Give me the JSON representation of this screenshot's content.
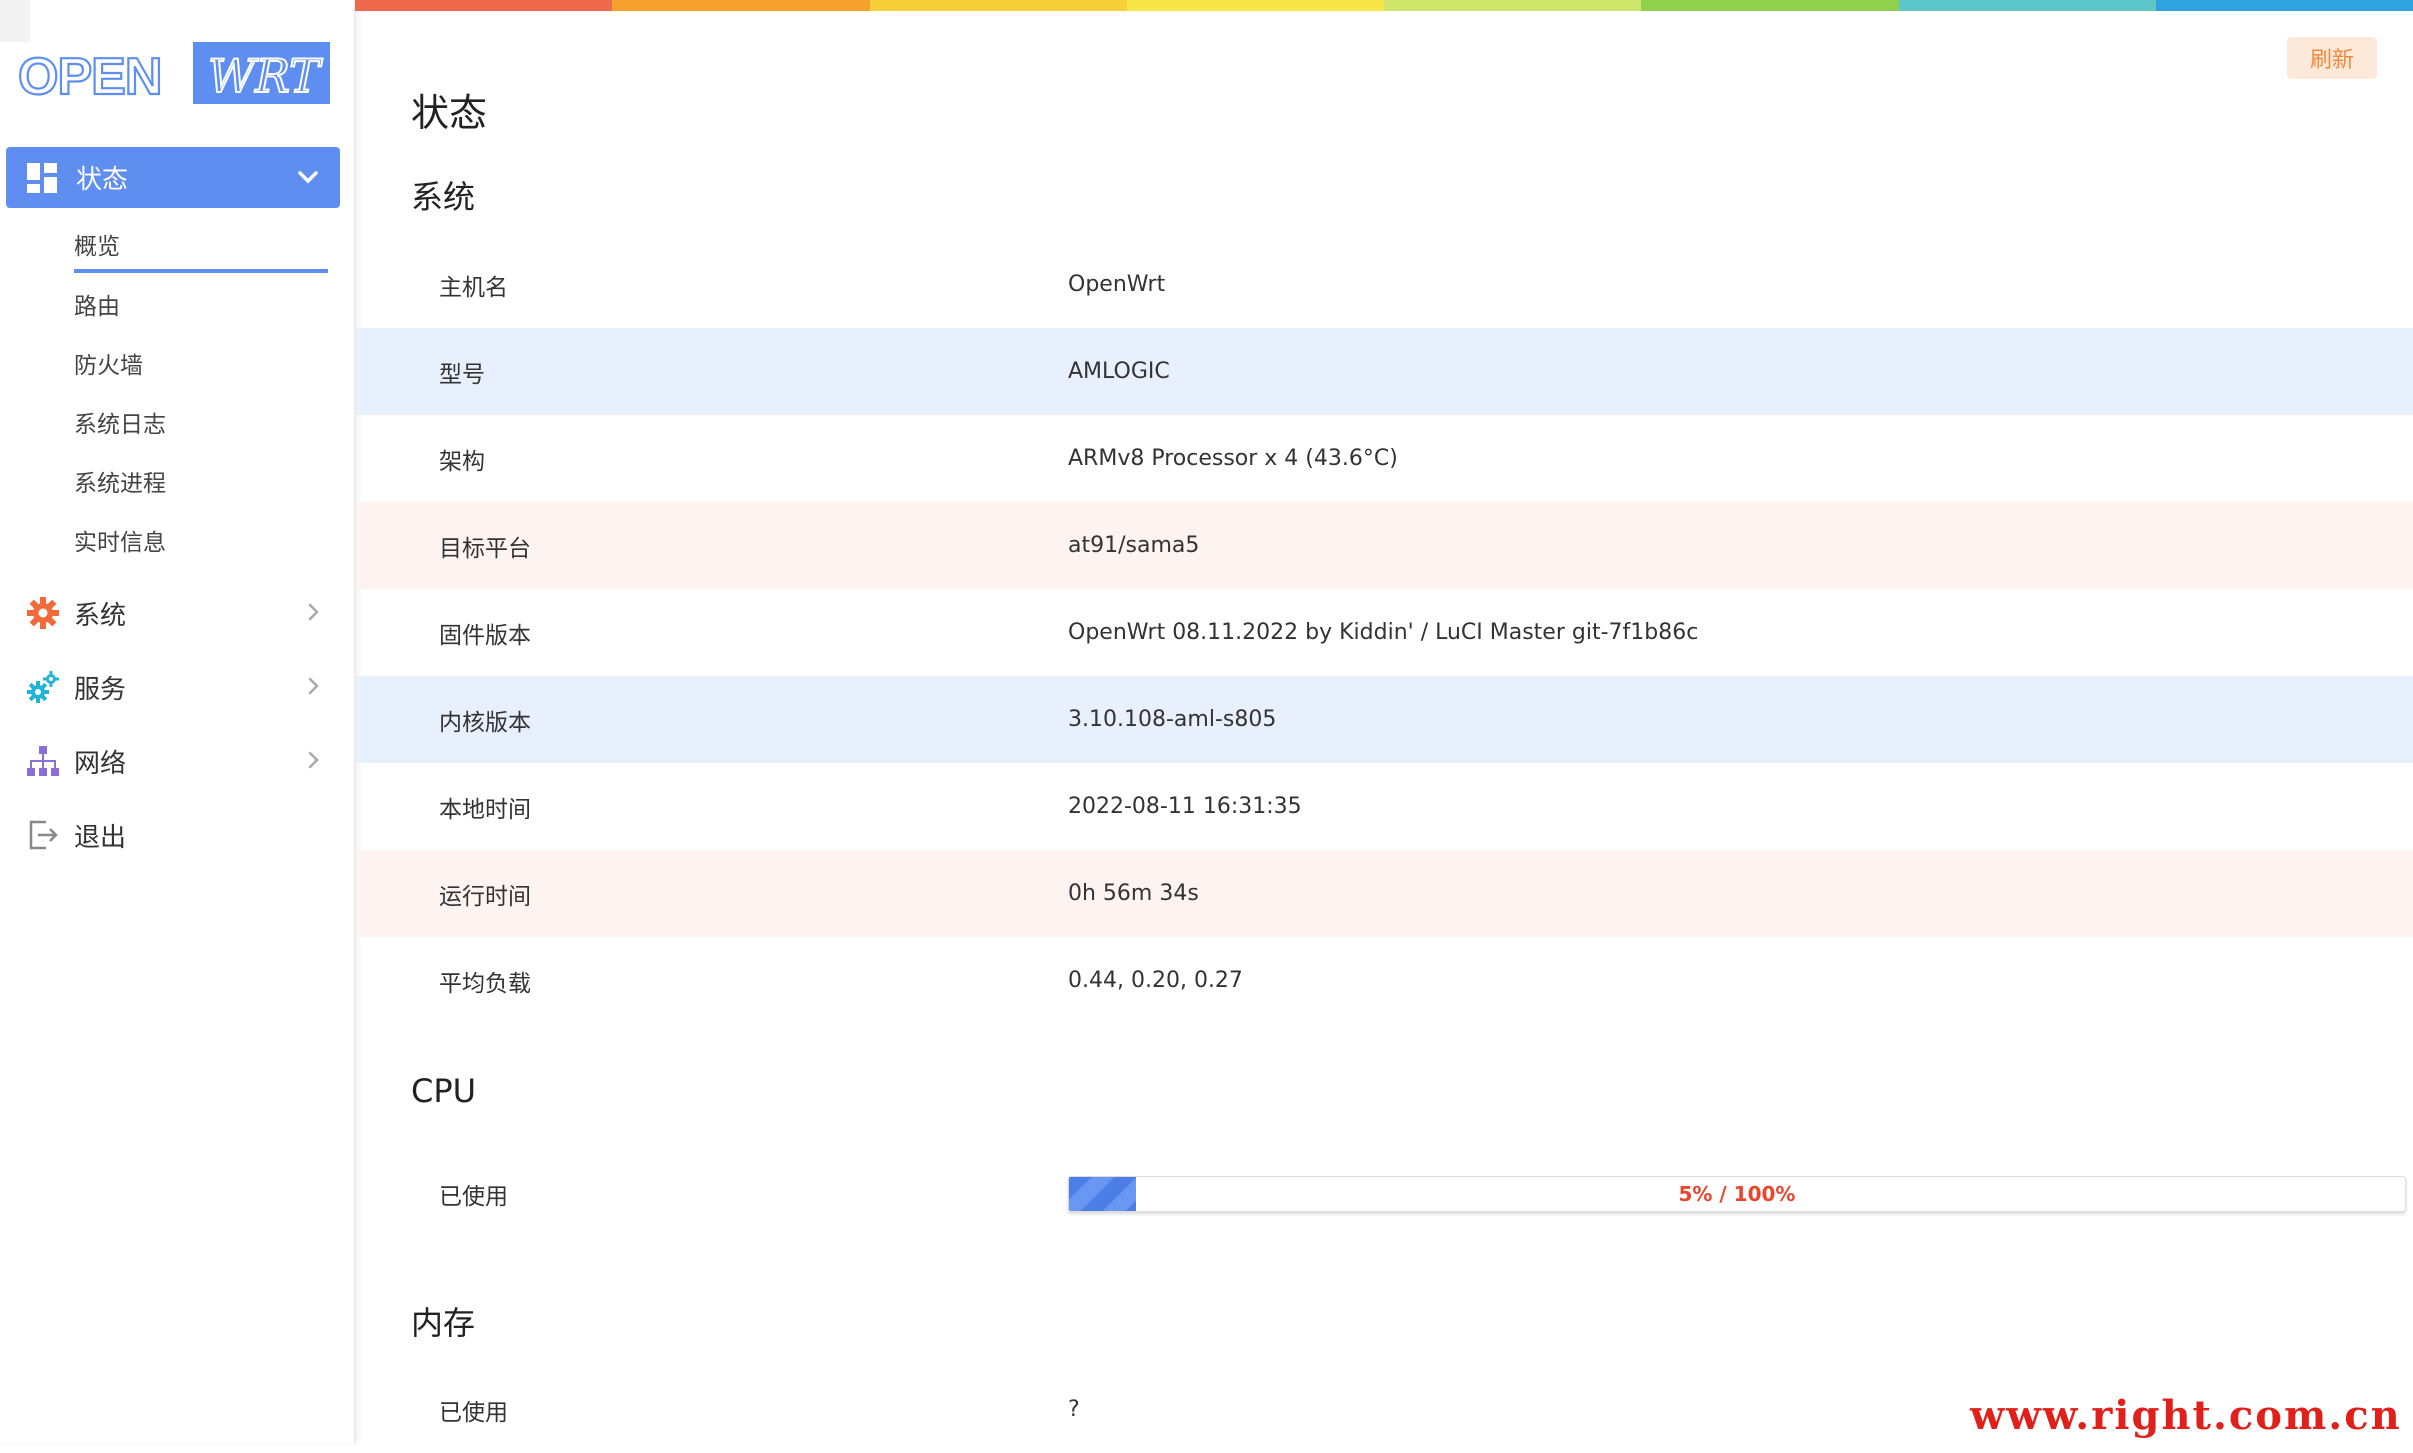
{
  "colors": {
    "accent": "#5e8ff0",
    "refresh_bg": "#fde9d9",
    "refresh_text": "#f08a3c",
    "row_blue": "#e8f0fd",
    "row_pink": "#fdf3f1",
    "progress_text": "#e8462d",
    "rainbow": [
      "#ee6a4b",
      "#f6a02e",
      "#f7cf3b",
      "#f8e548",
      "#cfe56a",
      "#8fd04c",
      "#5dc6c9",
      "#2ea3e0"
    ]
  },
  "logo": {
    "left": "OPEN",
    "right": "WRT"
  },
  "sidebar": {
    "active": {
      "label": "状态",
      "icon": "dashboard-icon"
    },
    "subitems": [
      {
        "label": "概览"
      },
      {
        "label": "路由"
      },
      {
        "label": "防火墙"
      },
      {
        "label": "系统日志"
      },
      {
        "label": "系统进程"
      },
      {
        "label": "实时信息"
      }
    ],
    "items": [
      {
        "label": "系统",
        "icon": "gear-icon"
      },
      {
        "label": "服务",
        "icon": "cogs-icon"
      },
      {
        "label": "网络",
        "icon": "network-icon"
      },
      {
        "label": "退出",
        "icon": "logout-icon"
      }
    ]
  },
  "header": {
    "refresh_label": "刷新",
    "title": "状态"
  },
  "system": {
    "title": "系统",
    "rows": [
      {
        "key": "主机名",
        "value": "OpenWrt"
      },
      {
        "key": "型号",
        "value": "AMLOGIC"
      },
      {
        "key": "架构",
        "value": "ARMv8 Processor x 4 (43.6°C)"
      },
      {
        "key": "目标平台",
        "value": "at91/sama5"
      },
      {
        "key": "固件版本",
        "value": "OpenWrt 08.11.2022 by Kiddin' / LuCI Master git-7f1b86c"
      },
      {
        "key": "内核版本",
        "value": "3.10.108-aml-s805"
      },
      {
        "key": "本地时间",
        "value": "2022-08-11 16:31:35"
      },
      {
        "key": "运行时间",
        "value": "0h 56m 34s"
      },
      {
        "key": "平均负载",
        "value": "0.44, 0.20, 0.27"
      }
    ]
  },
  "cpu": {
    "title": "CPU",
    "used_label": "已使用",
    "used_text": "5% / 100%",
    "used_percent": 5
  },
  "memory": {
    "title": "内存",
    "used_label": "已使用",
    "used_value": "?"
  },
  "watermark": "www.right.com.cn"
}
